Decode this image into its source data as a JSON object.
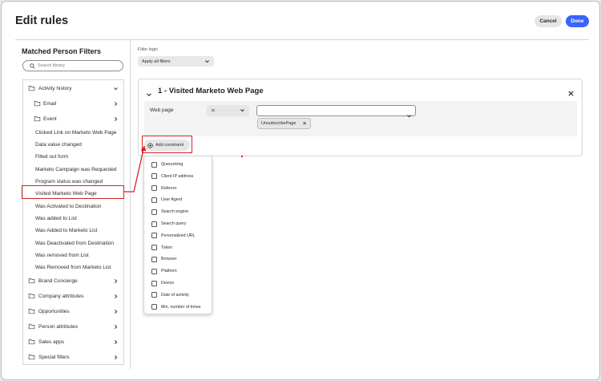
{
  "dialog": {
    "title": "Edit rules",
    "cancel_label": "Cancel",
    "done_label": "Done"
  },
  "left_panel": {
    "title": "Matched Person Filters",
    "search_placeholder": "Search library",
    "tree": [
      {
        "label": "Activity history",
        "kind": "folder",
        "chevron": "down"
      },
      {
        "label": "Email",
        "kind": "folder",
        "chevron": "right"
      },
      {
        "label": "Event",
        "kind": "folder",
        "chevron": "right"
      },
      {
        "label": "Clicked Link on Marketo Web Page",
        "kind": "item"
      },
      {
        "label": "Data value changed",
        "kind": "item"
      },
      {
        "label": "Filled out form",
        "kind": "item"
      },
      {
        "label": "Marketo Campaign was Requested",
        "kind": "item"
      },
      {
        "label": "Program status was changed",
        "kind": "item"
      },
      {
        "label": "Visited Marketo Web Page",
        "kind": "item",
        "selected": true
      },
      {
        "label": "Was Activated to Destination",
        "kind": "item"
      },
      {
        "label": "Was added to List",
        "kind": "item"
      },
      {
        "label": "Was Added to Marketo List",
        "kind": "item"
      },
      {
        "label": "Was Deactivated from Destination",
        "kind": "item"
      },
      {
        "label": "Was removed from List",
        "kind": "item"
      },
      {
        "label": "Was Removed from Marketo List",
        "kind": "item"
      },
      {
        "label": "Brand Concierge",
        "kind": "folder",
        "chevron": "right"
      },
      {
        "label": "Company attributes",
        "kind": "folder",
        "chevron": "right"
      },
      {
        "label": "Opportunities",
        "kind": "folder",
        "chevron": "right"
      },
      {
        "label": "Person attributes",
        "kind": "folder",
        "chevron": "right"
      },
      {
        "label": "Sales apps",
        "kind": "folder",
        "chevron": "right"
      },
      {
        "label": "Special filters",
        "kind": "folder",
        "chevron": "right"
      }
    ]
  },
  "main": {
    "filter_logic_label": "Filter logic",
    "filter_logic_value": "Apply all filters",
    "rule": {
      "title": "1 - Visited Marketo Web Page",
      "field_label": "Web page",
      "operator": "is",
      "value_tag": "UnsubscribePage",
      "add_constraint_label": "Add constraint"
    },
    "constraint_menu": [
      "Querystring",
      "Client IP address",
      "Referrer",
      "User Agent",
      "Search engine",
      "Search query",
      "Personalized URL",
      "Token",
      "Browser",
      "Platform",
      "Device",
      "Date of activity",
      "Min. number of times"
    ]
  },
  "colors": {
    "accent": "#3b63fb",
    "highlight_red": "#d32323"
  },
  "icons": [
    "search-icon",
    "folder-icon",
    "chevron-down-icon",
    "chevron-right-icon",
    "close-icon",
    "add-circle-icon",
    "checkbox-icon"
  ]
}
